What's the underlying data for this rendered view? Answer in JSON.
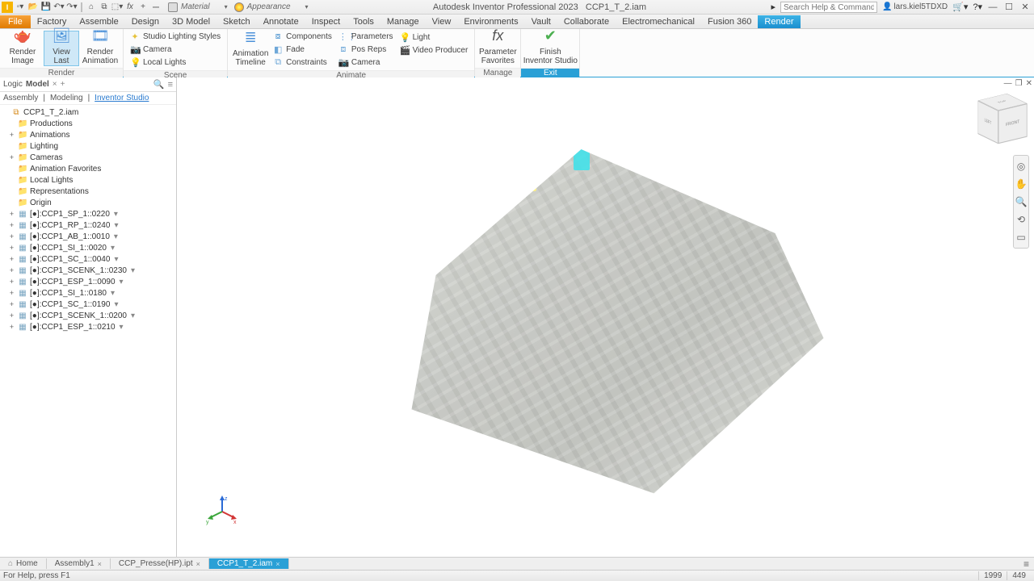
{
  "app": {
    "title_left": "Autodesk Inventor Professional 2023",
    "title_doc": "CCP1_T_2.iam",
    "search_placeholder": "Search Help & Commands...",
    "user": "lars.kiel5TDXD",
    "material_label": "Material",
    "appearance_label": "Appearance"
  },
  "menutabs": [
    "File",
    "Factory",
    "Assemble",
    "Design",
    "3D Model",
    "Sketch",
    "Annotate",
    "Inspect",
    "Tools",
    "Manage",
    "View",
    "Environments",
    "Vault",
    "Collaborate",
    "Electromechanical",
    "Fusion 360",
    "Render"
  ],
  "active_tab": "Render",
  "ribbon": {
    "render": {
      "render_image": "Render\nImage",
      "view_last": "View\nLast",
      "render_anim": "Render\nAnimation",
      "group": "Render"
    },
    "scene": {
      "lighting": "Studio Lighting Styles",
      "camera": "Camera",
      "local": "Local Lights",
      "group": "Scene"
    },
    "animate": {
      "timeline": "Animation\nTimeline",
      "components": "Components",
      "fade": "Fade",
      "constraints": "Constraints",
      "parameters": "Parameters",
      "posreps": "Pos Reps",
      "camera": "Camera",
      "light": "Light",
      "video": "Video Producer",
      "group": "Animate"
    },
    "manage": {
      "paramfav": "Parameter\nFavorites",
      "group": "Manage"
    },
    "exit": {
      "finish": "Finish\nInventor Studio",
      "group": "Exit"
    }
  },
  "browser": {
    "logic": "Logic",
    "model": "Model",
    "modes": {
      "assembly": "Assembly",
      "modeling": "Modeling",
      "studio": "Inventor Studio"
    },
    "root": "CCP1_T_2.iam",
    "folders": [
      "Productions",
      "Animations",
      "Lighting",
      "Cameras",
      "Animation Favorites",
      "Local Lights",
      "Representations",
      "Origin"
    ],
    "parts": [
      "[●]:CCP1_SP_1::0220",
      "[●]:CCP1_RP_1::0240",
      "[●]:CCP1_AB_1::0010",
      "[●]:CCP1_SI_1::0020",
      "[●]:CCP1_SC_1::0040",
      "[●]:CCP1_SCENK_1::0230",
      "[●]:CCP1_ESP_1::0090",
      "[●]:CCP1_SI_1::0180",
      "[●]:CCP1_SC_1::0190",
      "[●]:CCP1_SCENK_1::0200",
      "[●]:CCP1_ESP_1::0210"
    ]
  },
  "viewcube": {
    "top": "TOP",
    "left": "LEFT",
    "front": "FRONT"
  },
  "doctabs": {
    "home": "Home",
    "tabs": [
      "Assembly1",
      "CCP_Presse(HP).ipt",
      "CCP1_T_2.iam"
    ],
    "active": "CCP1_T_2.iam"
  },
  "status": {
    "help": "For Help, press F1",
    "x": "1999",
    "y": "449"
  }
}
